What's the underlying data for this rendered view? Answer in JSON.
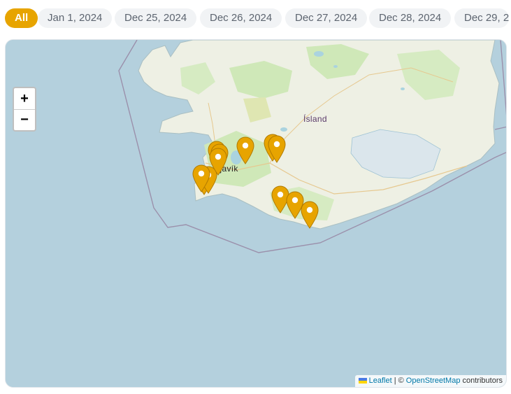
{
  "filters": [
    "All",
    "Jan 1, 2024",
    "Dec 25, 2024",
    "Dec 26, 2024",
    "Dec 27, 2024",
    "Dec 28, 2024",
    "Dec 29, 2"
  ],
  "active_filter": "All",
  "map": {
    "labels": {
      "country": "Ísland",
      "city": "Reykjavík"
    },
    "zoom_in": "+",
    "zoom_out": "−",
    "attribution": {
      "leaflet": "Leaflet",
      "sep": "| ©",
      "osm": "OpenStreetMap",
      "tail": "contributors"
    },
    "marker_count": 12,
    "colors": {
      "marker": "#e7a400",
      "sea": "#b4d0dd",
      "land": "#eef0e4",
      "chip_active": "#e7a400"
    }
  }
}
